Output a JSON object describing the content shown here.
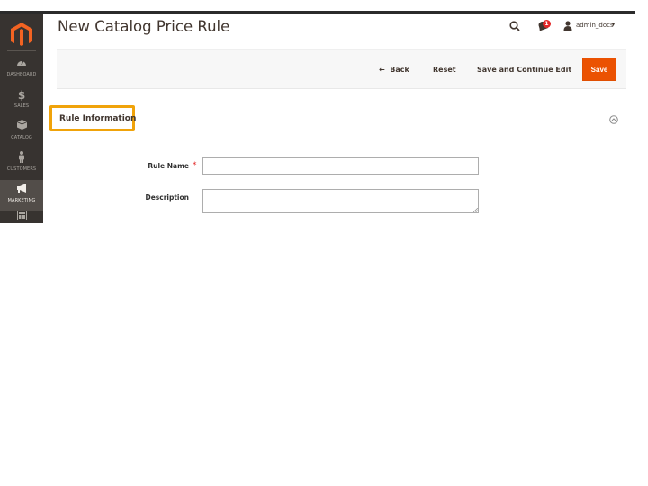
{
  "app": {
    "page_title": "New Catalog Price Rule",
    "accent_color": "#eb5202",
    "highlight_color": "#f0a30a"
  },
  "sidebar": {
    "logo": "magento-logo-icon",
    "items": [
      {
        "label": "DASHBOARD",
        "icon": "dashboard-gauge-icon"
      },
      {
        "label": "SALES",
        "icon": "dollar-icon"
      },
      {
        "label": "CATALOG",
        "icon": "box-icon"
      },
      {
        "label": "CUSTOMERS",
        "icon": "person-icon"
      },
      {
        "label": "MARKETING",
        "icon": "megaphone-icon",
        "active": true
      },
      {
        "label": "",
        "icon": "content-layout-icon"
      }
    ]
  },
  "header": {
    "search_icon": "search-icon",
    "notifications_count": "1",
    "username": "admin_docs",
    "caret": "▾"
  },
  "actions": {
    "back_arrow": "←",
    "back_label": "Back",
    "reset_label": "Reset",
    "save_continue_label": "Save and Continue Edit",
    "save_label": "Save"
  },
  "section": {
    "title": "Rule Information",
    "collapse_icon": "collapse-circle-icon"
  },
  "form": {
    "rule_name": {
      "label": "Rule Name",
      "required_marker": "*",
      "value": ""
    },
    "description": {
      "label": "Description",
      "value": ""
    }
  }
}
